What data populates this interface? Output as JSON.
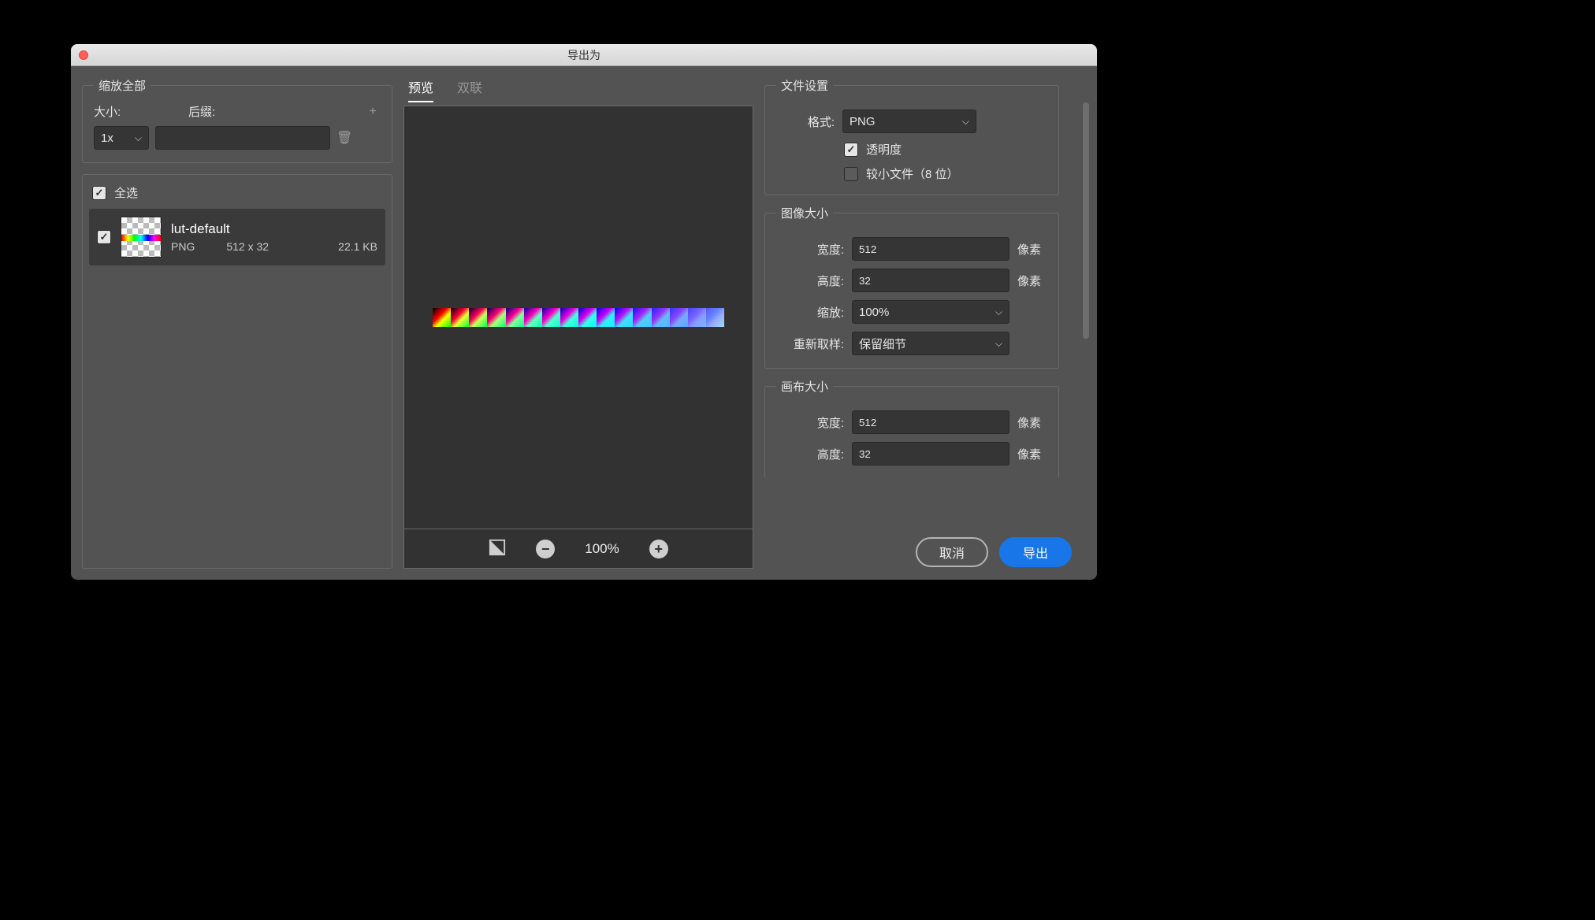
{
  "title": "导出为",
  "scale_all": {
    "legend": "缩放全部",
    "size_label": "大小:",
    "suffix_label": "后缀:",
    "size_value": "1x",
    "suffix_value": ""
  },
  "select_all_label": "全选",
  "asset": {
    "name": "lut-default",
    "format": "PNG",
    "dimensions": "512 x 32",
    "filesize": "22.1 KB"
  },
  "tabs": {
    "preview": "预览",
    "two_up": "双联"
  },
  "zoom": "100%",
  "file_settings": {
    "legend": "文件设置",
    "format_label": "格式:",
    "format_value": "PNG",
    "transparency_label": "透明度",
    "smaller_file_label": "较小文件（8 位）"
  },
  "image_size": {
    "legend": "图像大小",
    "width_label": "宽度:",
    "width_value": "512",
    "height_label": "高度:",
    "height_value": "32",
    "unit": "像素",
    "scale_label": "缩放:",
    "scale_value": "100%",
    "resample_label": "重新取样:",
    "resample_value": "保留细节"
  },
  "canvas_size": {
    "legend": "画布大小",
    "width_label": "宽度:",
    "width_value": "512",
    "height_label": "高度:",
    "height_value": "32",
    "unit": "像素"
  },
  "buttons": {
    "cancel": "取消",
    "export": "导出"
  }
}
